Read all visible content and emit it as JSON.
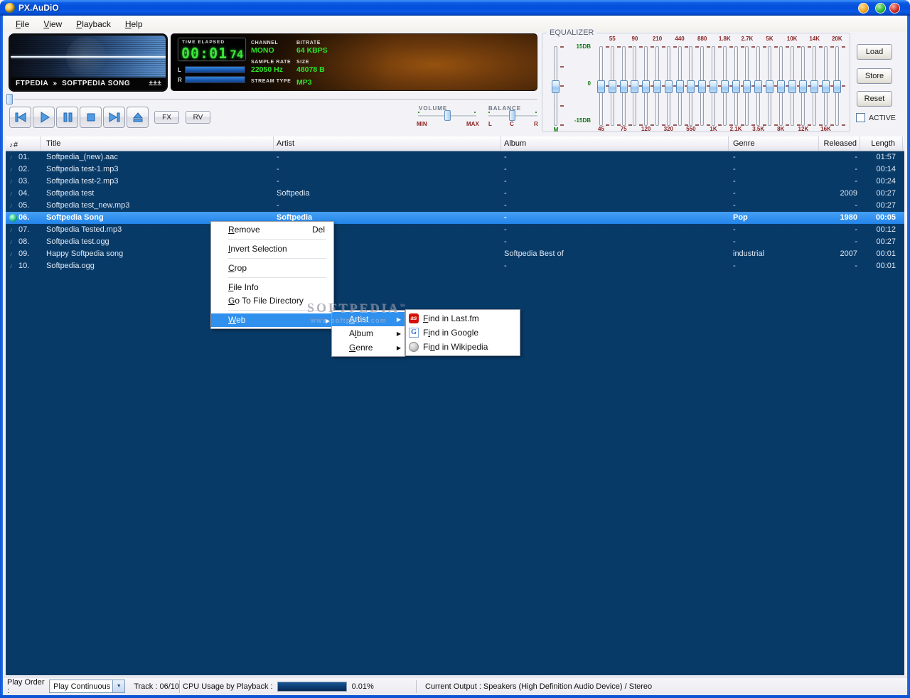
{
  "window": {
    "title": "PX.AuDiO"
  },
  "titlebar": {
    "buttons": [
      "minimize",
      "maximize",
      "close"
    ]
  },
  "menubar": [
    {
      "label": "File",
      "accel": 0
    },
    {
      "label": "View",
      "accel": 0
    },
    {
      "label": "Playback",
      "accel": 0
    },
    {
      "label": "Help",
      "accel": 0
    }
  ],
  "ticker": {
    "text": "FTPEDIA  »  SOFTPEDIA SONG        ±±±        S"
  },
  "display": {
    "time_label": "TIME ELAPSED",
    "time_main": "00:01",
    "time_frames": "74",
    "meters": [
      {
        "label": "L"
      },
      {
        "label": "R"
      }
    ],
    "info": [
      {
        "label": "CHANNEL",
        "value": "MONO"
      },
      {
        "label": "BITRATE",
        "value": "64 KBPS"
      },
      {
        "label": "SAMPLE RATE",
        "value": "22050 Hz"
      },
      {
        "label": "SIZE",
        "value": "48078 B"
      },
      {
        "label": "STREAM TYPE",
        "value": "MP3"
      }
    ]
  },
  "equalizer": {
    "title": "EQUALIZER",
    "master_label": "M",
    "db_labels": [
      "15DB",
      "0",
      "-15DB"
    ],
    "bands": [
      {
        "freq": "45",
        "pos": "bottom"
      },
      {
        "freq": "55",
        "pos": "top"
      },
      {
        "freq": "75",
        "pos": "bottom"
      },
      {
        "freq": "90",
        "pos": "top"
      },
      {
        "freq": "120",
        "pos": "bottom"
      },
      {
        "freq": "210",
        "pos": "top"
      },
      {
        "freq": "320",
        "pos": "bottom"
      },
      {
        "freq": "440",
        "pos": "top"
      },
      {
        "freq": "550",
        "pos": "bottom"
      },
      {
        "freq": "880",
        "pos": "top"
      },
      {
        "freq": "1K",
        "pos": "bottom"
      },
      {
        "freq": "1.8K",
        "pos": "top"
      },
      {
        "freq": "2.1K",
        "pos": "bottom"
      },
      {
        "freq": "2.7K",
        "pos": "top"
      },
      {
        "freq": "3.5K",
        "pos": "bottom"
      },
      {
        "freq": "5K",
        "pos": "top"
      },
      {
        "freq": "8K",
        "pos": "bottom"
      },
      {
        "freq": "10K",
        "pos": "top"
      },
      {
        "freq": "12K",
        "pos": "bottom"
      },
      {
        "freq": "14K",
        "pos": "top"
      },
      {
        "freq": "16K",
        "pos": "bottom"
      },
      {
        "freq": "20K",
        "pos": "top"
      }
    ],
    "buttons": [
      "Load",
      "Store",
      "Reset"
    ],
    "active_label": "ACTIVE",
    "active_checked": false
  },
  "transport": {
    "buttons": [
      "previous",
      "play",
      "pause",
      "stop",
      "next",
      "eject"
    ],
    "fx_label": "FX",
    "rv_label": "RV"
  },
  "volume": {
    "label": "VOLUME",
    "min_label": "MIN",
    "max_label": "MAX",
    "value_pct": 50
  },
  "balance": {
    "label": "BALANCE",
    "left_label": "L",
    "center_label": "C",
    "right_label": "R",
    "value_pct": 48
  },
  "playlist": {
    "columns": [
      {
        "key": "num",
        "label": "#"
      },
      {
        "key": "title",
        "label": "Title"
      },
      {
        "key": "artist",
        "label": "Artist"
      },
      {
        "key": "album",
        "label": "Album"
      },
      {
        "key": "genre",
        "label": "Genre"
      },
      {
        "key": "released",
        "label": "Released"
      },
      {
        "key": "length",
        "label": "Length"
      }
    ],
    "rows": [
      {
        "num": "01.",
        "title": "Softpedia_(new).aac",
        "artist": "-",
        "album": "-",
        "genre": "-",
        "released": "-",
        "length": "01:57",
        "selected": false,
        "playing": false
      },
      {
        "num": "02.",
        "title": "Softpedia test-1.mp3",
        "artist": "-",
        "album": "-",
        "genre": "-",
        "released": "-",
        "length": "00:14",
        "selected": false,
        "playing": false
      },
      {
        "num": "03.",
        "title": "Softpedia test-2.mp3",
        "artist": "-",
        "album": "-",
        "genre": "-",
        "released": "-",
        "length": "00:24",
        "selected": false,
        "playing": false
      },
      {
        "num": "04.",
        "title": "Softpedia test",
        "artist": "Softpedia",
        "album": "-",
        "genre": "-",
        "released": "2009",
        "length": "00:27",
        "selected": false,
        "playing": false
      },
      {
        "num": "05.",
        "title": "Softpedia test_new.mp3",
        "artist": "-",
        "album": "-",
        "genre": "-",
        "released": "-",
        "length": "00:27",
        "selected": false,
        "playing": false
      },
      {
        "num": "06.",
        "title": "Softpedia Song",
        "artist": "Softpedia",
        "album": "-",
        "genre": "Pop",
        "released": "1980",
        "length": "00:05",
        "selected": true,
        "playing": true
      },
      {
        "num": "07.",
        "title": "Softpedia Tested.mp3",
        "artist": "-",
        "album": "-",
        "genre": "-",
        "released": "-",
        "length": "00:12",
        "selected": false,
        "playing": false
      },
      {
        "num": "08.",
        "title": "Softpedia test.ogg",
        "artist": "-",
        "album": "-",
        "genre": "-",
        "released": "-",
        "length": "00:27",
        "selected": false,
        "playing": false
      },
      {
        "num": "09.",
        "title": "Happy Softpedia song",
        "artist": "-",
        "album": "Softpedia Best of",
        "genre": "industrial",
        "released": "2007",
        "length": "00:01",
        "selected": false,
        "playing": false
      },
      {
        "num": "10.",
        "title": "Softpedia.ogg",
        "artist": "-",
        "album": "-",
        "genre": "-",
        "released": "-",
        "length": "00:01",
        "selected": false,
        "playing": false
      }
    ]
  },
  "context_menu": [
    {
      "type": "item",
      "label": "Remove",
      "accel": 0,
      "shortcut": "Del"
    },
    {
      "type": "sep"
    },
    {
      "type": "item",
      "label": "Invert Selection",
      "accel": 0
    },
    {
      "type": "sep"
    },
    {
      "type": "item",
      "label": "Crop",
      "accel": 0
    },
    {
      "type": "sep"
    },
    {
      "type": "item",
      "label": "File Info",
      "accel": 0
    },
    {
      "type": "item",
      "label": "Go To File Directory",
      "accel": 0
    },
    {
      "type": "sep"
    },
    {
      "type": "item",
      "label": "Web",
      "accel": 0,
      "submenu": true,
      "highlighted": true
    }
  ],
  "web_submenu": [
    {
      "label": "Artist",
      "accel": 0,
      "submenu": true,
      "highlighted": true
    },
    {
      "label": "Album",
      "accel": 1,
      "submenu": true,
      "highlighted": false
    },
    {
      "label": "Genre",
      "accel": 0,
      "submenu": true,
      "highlighted": false
    }
  ],
  "find_submenu": [
    {
      "label": "Find in Last.fm",
      "accel": 0,
      "icon": "lastfm",
      "icon_text": "as"
    },
    {
      "label": "Find in Google",
      "accel": 1,
      "icon": "google",
      "icon_text": "G"
    },
    {
      "label": "Find in Wikipedia",
      "accel": 2,
      "icon": "wikipedia",
      "icon_text": ""
    }
  ],
  "watermark": {
    "line1": "SOFTPEDIA",
    "tm": "™",
    "line2": "www.softpedia.com"
  },
  "statusbar": {
    "play_order_label": "Play Order :",
    "play_order_value": "Play Continuous",
    "track": "Track : 06/10",
    "cpu_label": "CPU Usage by Playback :",
    "cpu_value": "0.01%",
    "output": "Current Output : Speakers (High Definition Audio Device) / Stereo"
  },
  "colors": {
    "titlebar_blue": "#0D55D4",
    "playlist_bg": "#083A68",
    "selection_blue": "#2E8FEF",
    "value_green": "#2BE42B",
    "freq_maroon": "#8B2424",
    "db_green": "#127812",
    "menu_highlight": "#3090EE"
  }
}
